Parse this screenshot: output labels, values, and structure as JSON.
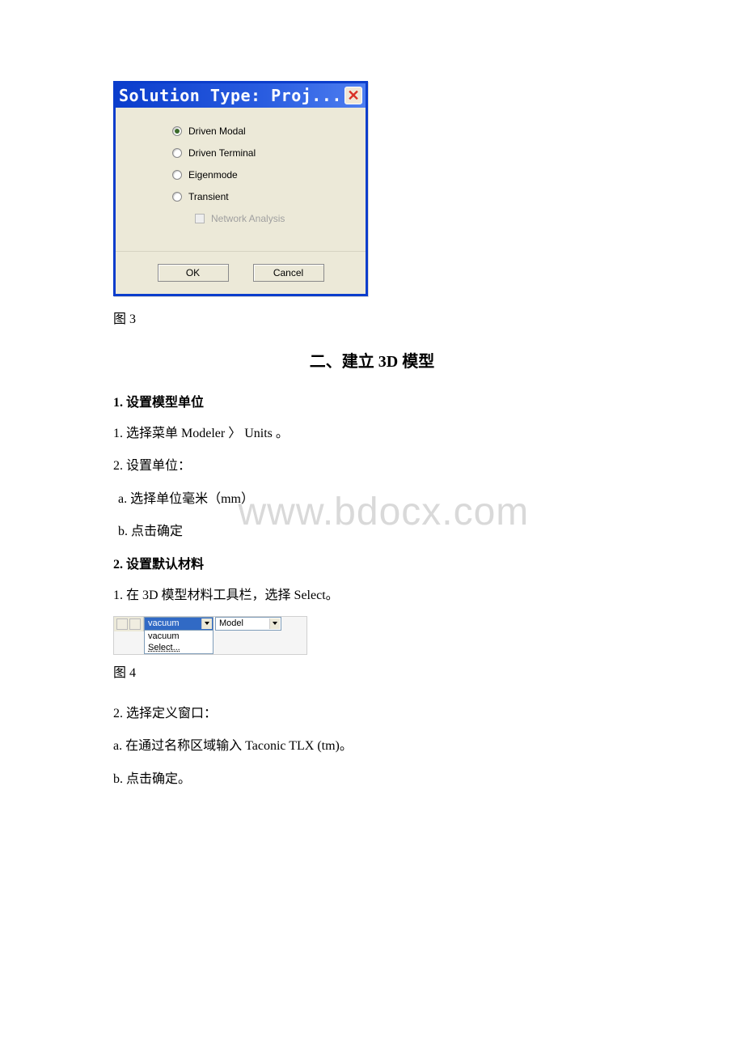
{
  "dialog": {
    "title": "Solution Type: Proj...",
    "options": {
      "driven_modal": "Driven Modal",
      "driven_terminal": "Driven Terminal",
      "eigenmode": "Eigenmode",
      "transient": "Transient",
      "network_analysis": "Network Analysis"
    },
    "ok": "OK",
    "cancel": "Cancel"
  },
  "fig3": "图 3",
  "section2_title": "二、建立 3D 模型",
  "h1": "1. 设置模型单位",
  "p1": "1. 选择菜单 Modeler 〉 Units 。",
  "p2": "2. 设置单位：",
  "p3": "a. 选择单位毫米（mm）",
  "p4": "b. 点击确定",
  "h2": " 2. 设置默认材料",
  "p5": "1. 在 3D 模型材料工具栏，选择 Select。",
  "toolbar": {
    "combo1_selected": "vacuum",
    "drop_item1": "vacuum",
    "drop_item2": "Select...",
    "combo2": "Model"
  },
  "fig4": "图 4",
  "p6": "2. 选择定义窗口：",
  "p7": "a. 在通过名称区域输入 Taconic TLX (tm)。",
  "p8": "b. 点击确定。",
  "watermark": "www.bdocx.com"
}
